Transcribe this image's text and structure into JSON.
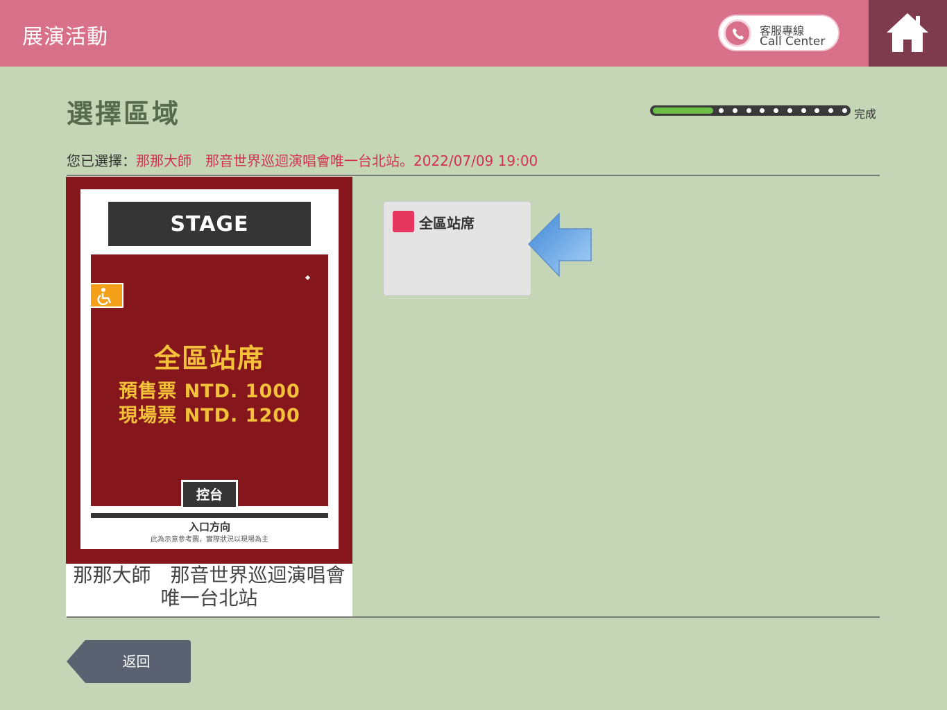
{
  "header": {
    "title": "展演活動",
    "call_center_zh": "客服專線",
    "call_center_en": "Call Center",
    "home_icon": "home-icon",
    "phone_icon": "phone-icon"
  },
  "page": {
    "title": "選擇區域"
  },
  "progress": {
    "label": "完成",
    "fraction": 0.3,
    "steps": 10
  },
  "selection": {
    "label": "您已選擇：",
    "value": "那那大師　那音世界巡迴演唱會唯一台北站。2022/07/09 19:00"
  },
  "seat_map": {
    "stage": "STAGE",
    "zone_name": "全區站席",
    "presale_price": "預售票 NTD. 1000",
    "door_price": "現場票 NTD. 1200",
    "control": "控台",
    "entrance": "入口方向",
    "note": "此為示意參考圖，實際狀況以現場為主",
    "accessible_icon": "wheelchair-icon"
  },
  "event_caption": "那那大師　那音世界巡迴演唱會唯一台北站",
  "zones": [
    {
      "label": "全區站席",
      "color": "#e6375f"
    }
  ],
  "back_button": "返回",
  "colors": {
    "header": "#d8708a",
    "home": "#7e3b4e",
    "background": "#c5d6b6",
    "accent": "#d2304b"
  }
}
